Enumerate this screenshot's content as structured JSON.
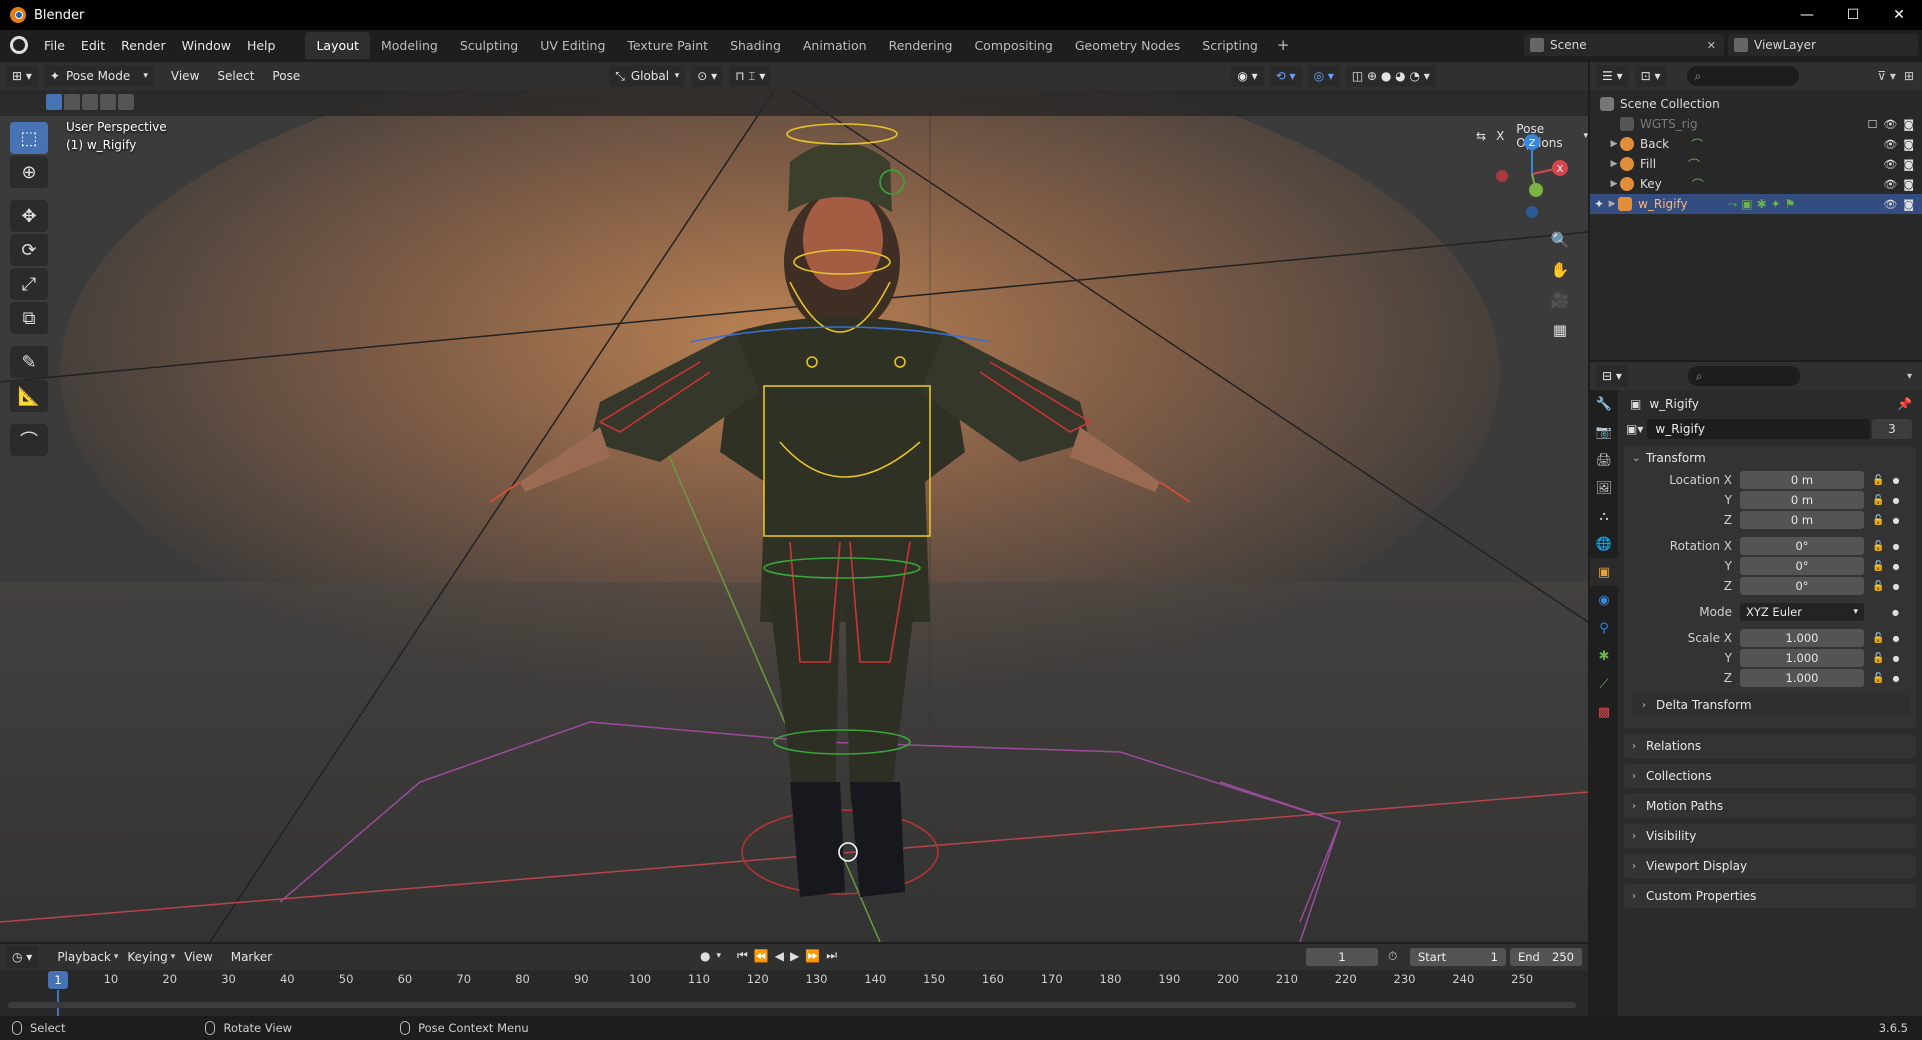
{
  "window": {
    "title": "Blender",
    "controls": [
      "—",
      "☐",
      "✕"
    ]
  },
  "topbar": {
    "menus": [
      "File",
      "Edit",
      "Render",
      "Window",
      "Help"
    ],
    "workspaces": [
      "Layout",
      "Modeling",
      "Sculpting",
      "UV Editing",
      "Texture Paint",
      "Shading",
      "Animation",
      "Rendering",
      "Compositing",
      "Geometry Nodes",
      "Scripting"
    ],
    "active_workspace": "Layout",
    "add_label": "+",
    "scene": "Scene",
    "view_layer": "ViewLayer"
  },
  "viewport": {
    "mode": "Pose Mode",
    "menus": [
      "View",
      "Select",
      "Pose"
    ],
    "orientation": "Global",
    "pose_options": "Pose Options",
    "perspective_label": "User Perspective",
    "object_label": "(1) w_Rigify",
    "gizmo": {
      "z": "Z",
      "x": "X"
    },
    "tools": [
      "select-box",
      "cursor",
      "move",
      "rotate",
      "scale",
      "transform",
      "annotate",
      "measure",
      "pose-relax"
    ]
  },
  "outliner": {
    "root": "Scene Collection",
    "items": [
      {
        "label": "WGTS_rig",
        "dim": true,
        "selected": false
      },
      {
        "label": "Back",
        "dim": false,
        "selected": false
      },
      {
        "label": "Fill",
        "dim": false,
        "selected": false
      },
      {
        "label": "Key",
        "dim": false,
        "selected": false
      },
      {
        "label": "w_Rigify",
        "dim": false,
        "selected": true
      }
    ]
  },
  "properties": {
    "object_name": "w_Rigify",
    "datablock_name": "w_Rigify",
    "user_count": "3",
    "transform_title": "Transform",
    "location": {
      "label_x": "Location X",
      "label_y": "Y",
      "label_z": "Z",
      "x": "0 m",
      "y": "0 m",
      "z": "0 m"
    },
    "rotation": {
      "label_x": "Rotation X",
      "label_y": "Y",
      "label_z": "Z",
      "x": "0°",
      "y": "0°",
      "z": "0°"
    },
    "mode_label": "Mode",
    "mode_value": "XYZ Euler",
    "scale": {
      "label_x": "Scale X",
      "label_y": "Y",
      "label_z": "Z",
      "x": "1.000",
      "y": "1.000",
      "z": "1.000"
    },
    "delta_transform": "Delta Transform",
    "panels": [
      "Relations",
      "Collections",
      "Motion Paths",
      "Visibility",
      "Viewport Display",
      "Custom Properties"
    ]
  },
  "timeline": {
    "menus": [
      "Playback",
      "Keying",
      "View",
      "Marker"
    ],
    "current_frame": "1",
    "start_label": "Start",
    "start": "1",
    "end_label": "End",
    "end": "250",
    "ticks": [
      "10",
      "20",
      "30",
      "40",
      "50",
      "60",
      "70",
      "80",
      "90",
      "100",
      "110",
      "120",
      "130",
      "140",
      "150",
      "160",
      "170",
      "180",
      "190",
      "200",
      "210",
      "220",
      "230",
      "240",
      "250"
    ],
    "cursor_label": "1"
  },
  "statusbar": {
    "left": "Select",
    "middle": "Rotate View",
    "right": "Pose Context Menu",
    "version": "3.6.5"
  },
  "colors": {
    "accent": "#4772b3",
    "selection": "#334d80",
    "orange": "#e87d0d",
    "axis_x": "#d8474d",
    "axis_y": "#7cb342",
    "axis_z": "#3a86d8"
  }
}
